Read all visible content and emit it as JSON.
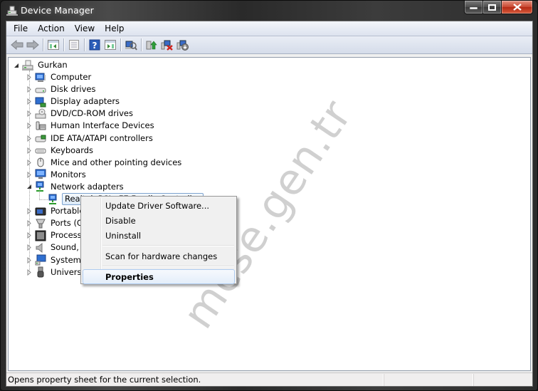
{
  "window": {
    "title": "Device Manager",
    "controls": {
      "minimize": "minimize",
      "maximize": "maximize",
      "close": "close"
    }
  },
  "menubar": {
    "items": [
      {
        "label": "File"
      },
      {
        "label": "Action"
      },
      {
        "label": "View"
      },
      {
        "label": "Help"
      }
    ]
  },
  "toolbar": {
    "buttons": [
      {
        "icon": "back-arrow-icon",
        "tooltip": "Back"
      },
      {
        "icon": "forward-arrow-icon",
        "tooltip": "Forward"
      },
      {
        "icon": "show-hide-console-tree-icon",
        "tooltip": "Show/Hide Console Tree"
      },
      {
        "icon": "properties-icon",
        "tooltip": "Properties"
      },
      {
        "icon": "help-icon",
        "tooltip": "Help"
      },
      {
        "icon": "show-hide-action-pane-icon",
        "tooltip": "Show/Hide Action Pane"
      },
      {
        "icon": "scan-hardware-icon",
        "tooltip": "Scan for hardware changes"
      },
      {
        "icon": "update-driver-icon",
        "tooltip": "Update Driver Software"
      },
      {
        "icon": "uninstall-icon",
        "tooltip": "Uninstall"
      },
      {
        "icon": "disable-icon",
        "tooltip": "Disable"
      }
    ]
  },
  "tree": {
    "root": {
      "label": "Gurkan",
      "expanded": true
    },
    "categories": [
      {
        "label": "Computer",
        "icon": "computer-icon"
      },
      {
        "label": "Disk drives",
        "icon": "disk-drive-icon"
      },
      {
        "label": "Display adapters",
        "icon": "display-adapter-icon"
      },
      {
        "label": "DVD/CD-ROM drives",
        "icon": "dvd-drive-icon"
      },
      {
        "label": "Human Interface Devices",
        "icon": "hid-icon"
      },
      {
        "label": "IDE ATA/ATAPI controllers",
        "icon": "ide-controller-icon"
      },
      {
        "label": "Keyboards",
        "icon": "keyboard-icon"
      },
      {
        "label": "Mice and other pointing devices",
        "icon": "mouse-icon"
      },
      {
        "label": "Monitors",
        "icon": "monitor-icon"
      },
      {
        "label": "Network adapters",
        "icon": "network-adapter-icon",
        "expanded": true,
        "children": [
          {
            "label": "Realtek PCIe FE Family Controller",
            "selected": true
          }
        ]
      },
      {
        "label": "Portable Devices",
        "icon": "portable-device-icon"
      },
      {
        "label": "Ports (COM & LPT)",
        "icon": "port-icon"
      },
      {
        "label": "Processors",
        "icon": "processor-icon"
      },
      {
        "label": "Sound, video and game controllers",
        "icon": "sound-icon"
      },
      {
        "label": "System devices",
        "icon": "system-device-icon"
      },
      {
        "label": "Universal Serial Bus controllers",
        "icon": "usb-icon"
      }
    ]
  },
  "context_menu": {
    "items": [
      {
        "label": "Update Driver Software..."
      },
      {
        "label": "Disable"
      },
      {
        "label": "Uninstall"
      },
      {
        "separator": true
      },
      {
        "label": "Scan for hardware changes"
      },
      {
        "separator": true
      },
      {
        "label": "Properties",
        "bold": true,
        "highlighted": true
      }
    ]
  },
  "statusbar": {
    "text": "Opens property sheet for the current selection."
  },
  "watermark": "mcse.gen.tr",
  "colors": {
    "selection_border": "#7da2ce",
    "menu_highlight_border": "#aecbf0",
    "close_button": "#c8462f"
  }
}
